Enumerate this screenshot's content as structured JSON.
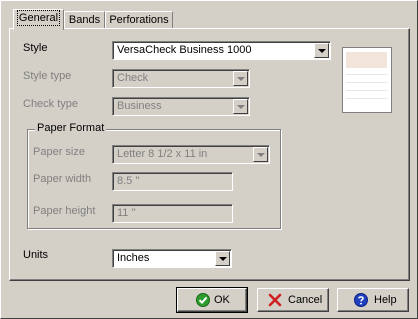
{
  "tabs": [
    {
      "label": "General",
      "active": true
    },
    {
      "label": "Bands",
      "active": false
    },
    {
      "label": "Perforations",
      "active": false
    }
  ],
  "form": {
    "style_label": "Style",
    "style_value": "VersaCheck Business 1000",
    "style_type_label": "Style type",
    "style_type_value": "Check",
    "check_type_label": "Check type",
    "check_type_value": "Business",
    "paper_format_title": "Paper Format",
    "paper_size_label": "Paper size",
    "paper_size_value": "Letter 8 1/2 x 11 in",
    "paper_width_label": "Paper width",
    "paper_width_value": "8.5 ''",
    "paper_height_label": "Paper height",
    "paper_height_value": "11 ''",
    "units_label": "Units",
    "units_value": "Inches"
  },
  "buttons": {
    "ok_label": "OK",
    "cancel_label": "Cancel",
    "help_label": "Help"
  },
  "colors": {
    "face": "#d4d0c8",
    "ok_icon": "#2e9c2e",
    "cancel_icon": "#d02020",
    "help_icon": "#2040c0"
  },
  "icons": {
    "ok": "checkmark-circle-icon",
    "cancel": "red-x-icon",
    "help": "question-circle-icon"
  }
}
